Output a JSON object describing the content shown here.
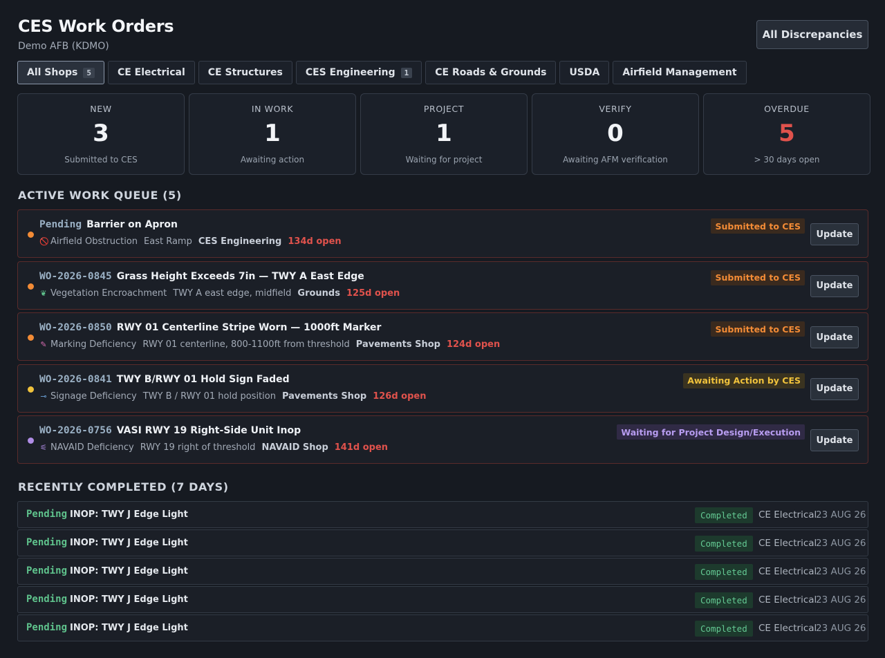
{
  "header": {
    "title": "CES Work Orders",
    "subtitle": "Demo AFB (KDMO)",
    "all_discrepancies_label": "All Discrepancies"
  },
  "tabs": [
    {
      "label": "All Shops",
      "badge": "5",
      "active": true
    },
    {
      "label": "CE Electrical",
      "badge": null
    },
    {
      "label": "CE Structures",
      "badge": null
    },
    {
      "label": "CES Engineering",
      "badge": "1"
    },
    {
      "label": "CE Roads & Grounds",
      "badge": null
    },
    {
      "label": "USDA",
      "badge": null
    },
    {
      "label": "Airfield Management",
      "badge": null
    }
  ],
  "stats": [
    {
      "label": "NEW",
      "value": "3",
      "desc": "Submitted to CES",
      "alert": false
    },
    {
      "label": "IN WORK",
      "value": "1",
      "desc": "Awaiting action",
      "alert": false
    },
    {
      "label": "PROJECT",
      "value": "1",
      "desc": "Waiting for project",
      "alert": false
    },
    {
      "label": "VERIFY",
      "value": "0",
      "desc": "Awaiting AFM verification",
      "alert": false
    },
    {
      "label": "OVERDUE",
      "value": "5",
      "desc": "> 30 days open",
      "alert": true
    }
  ],
  "queue": {
    "title": "ACTIVE WORK QUEUE (5)",
    "update_label": "Update",
    "items": [
      {
        "id": "Pending",
        "title": "Barrier on Apron",
        "category": "Airfield Obstruction",
        "icon": "prohibited-icon",
        "icon_glyph": "🚫",
        "icon_color": "#e0524c",
        "location": "East Ramp",
        "shop": "CES Engineering",
        "age": "134d open",
        "status": "Submitted to CES",
        "dot_color": "#f28b36",
        "status_bg": "#3a2a1e",
        "status_color": "#f28b36"
      },
      {
        "id": "WO-2026-0845",
        "title": "Grass Height Exceeds 7in — TWY A East Edge",
        "category": "Vegetation Encroachment",
        "icon": "plant-icon",
        "icon_glyph": "❦",
        "icon_color": "#5fc28c",
        "location": "TWY A east edge, midfield",
        "shop": "Grounds",
        "age": "125d open",
        "status": "Submitted to CES",
        "dot_color": "#f28b36",
        "status_bg": "#3a2a1e",
        "status_color": "#f28b36"
      },
      {
        "id": "WO-2026-0850",
        "title": "RWY 01 Centerline Stripe Worn — 1000ft Marker",
        "category": "Marking Deficiency",
        "icon": "paintbrush-icon",
        "icon_glyph": "✎",
        "icon_color": "#d66bb0",
        "location": "RWY 01 centerline, 800-1100ft from threshold",
        "shop": "Pavements Shop",
        "age": "124d open",
        "status": "Submitted to CES",
        "dot_color": "#f28b36",
        "status_bg": "#3a2a1e",
        "status_color": "#f28b36"
      },
      {
        "id": "WO-2026-0841",
        "title": "TWY B/RWY 01 Hold Sign Faded",
        "category": "Signage Deficiency",
        "icon": "signpost-icon",
        "icon_glyph": "⊸",
        "icon_color": "#6fa8e0",
        "location": "TWY B / RWY 01 hold position",
        "shop": "Pavements Shop",
        "age": "126d open",
        "status": "Awaiting Action by CES",
        "dot_color": "#f0c23c",
        "status_bg": "#3a3320",
        "status_color": "#f0c23c"
      },
      {
        "id": "WO-2026-0756",
        "title": "VASI RWY 19 Right-Side Unit Inop",
        "category": "NAVAID Deficiency",
        "icon": "antenna-icon",
        "icon_glyph": "⚟",
        "icon_color": "#b08de6",
        "location": "RWY 19 right of threshold",
        "shop": "NAVAID Shop",
        "age": "141d open",
        "status": "Waiting for Project Design/Execution",
        "dot_color": "#b08de6",
        "status_bg": "#302a45",
        "status_color": "#b79cf0"
      }
    ]
  },
  "completed": {
    "title": "RECENTLY COMPLETED (7 DAYS)",
    "items": [
      {
        "id": "Pending",
        "title": "INOP: TWY J Edge Light",
        "status": "Completed",
        "shop": "CE Electrical",
        "date": "23 AUG 26"
      },
      {
        "id": "Pending",
        "title": "INOP: TWY J Edge Light",
        "status": "Completed",
        "shop": "CE Electrical",
        "date": "23 AUG 26"
      },
      {
        "id": "Pending",
        "title": "INOP: TWY J Edge Light",
        "status": "Completed",
        "shop": "CE Electrical",
        "date": "23 AUG 26"
      },
      {
        "id": "Pending",
        "title": "INOP: TWY J Edge Light",
        "status": "Completed",
        "shop": "CE Electrical",
        "date": "23 AUG 26"
      },
      {
        "id": "Pending",
        "title": "INOP: TWY J Edge Light",
        "status": "Completed",
        "shop": "CE Electrical",
        "date": "23 AUG 26"
      }
    ]
  }
}
